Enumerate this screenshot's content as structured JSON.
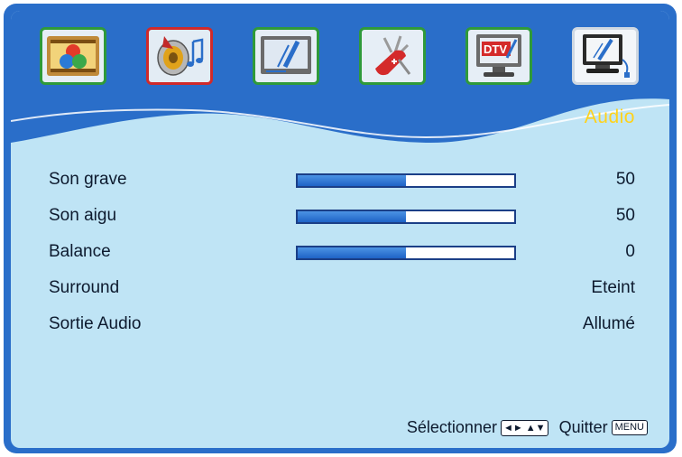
{
  "header": {
    "section_title": "Audio"
  },
  "tabs": [
    {
      "name": "picture-tab",
      "icon": "picture-palette-icon",
      "active": false
    },
    {
      "name": "audio-tab",
      "icon": "speaker-music-icon",
      "active": true
    },
    {
      "name": "screen-tab",
      "icon": "screen-display-icon",
      "active": false
    },
    {
      "name": "tools-tab",
      "icon": "swiss-knife-tools-icon",
      "active": false
    },
    {
      "name": "dtv-tab",
      "icon": "dtv-monitor-icon",
      "active": false
    },
    {
      "name": "pc-tab",
      "icon": "pc-connection-icon",
      "active": false
    }
  ],
  "settings": [
    {
      "label": "Son grave",
      "value": "50",
      "level": 0.5
    },
    {
      "label": "Son aigu",
      "value": "50",
      "level": 0.5
    },
    {
      "label": "Balance",
      "value": "0",
      "level": 0.5
    },
    {
      "label": "Surround",
      "value": "Eteint"
    },
    {
      "label": "Sortie Audio",
      "value": "Allumé"
    }
  ],
  "footer": {
    "select_label": "Sélectionner",
    "select_keys": "◄► ▲▼",
    "quit_label": "Quitter",
    "menu_key": "MENU"
  },
  "colors": {
    "frame": "#2a6ec9",
    "panel": "#bfe4f5",
    "accent_title": "#ffd21a",
    "slider_fill": "#1e63c6",
    "tab_border": "#2f9a3a",
    "tab_active_border": "#d02a2a"
  }
}
